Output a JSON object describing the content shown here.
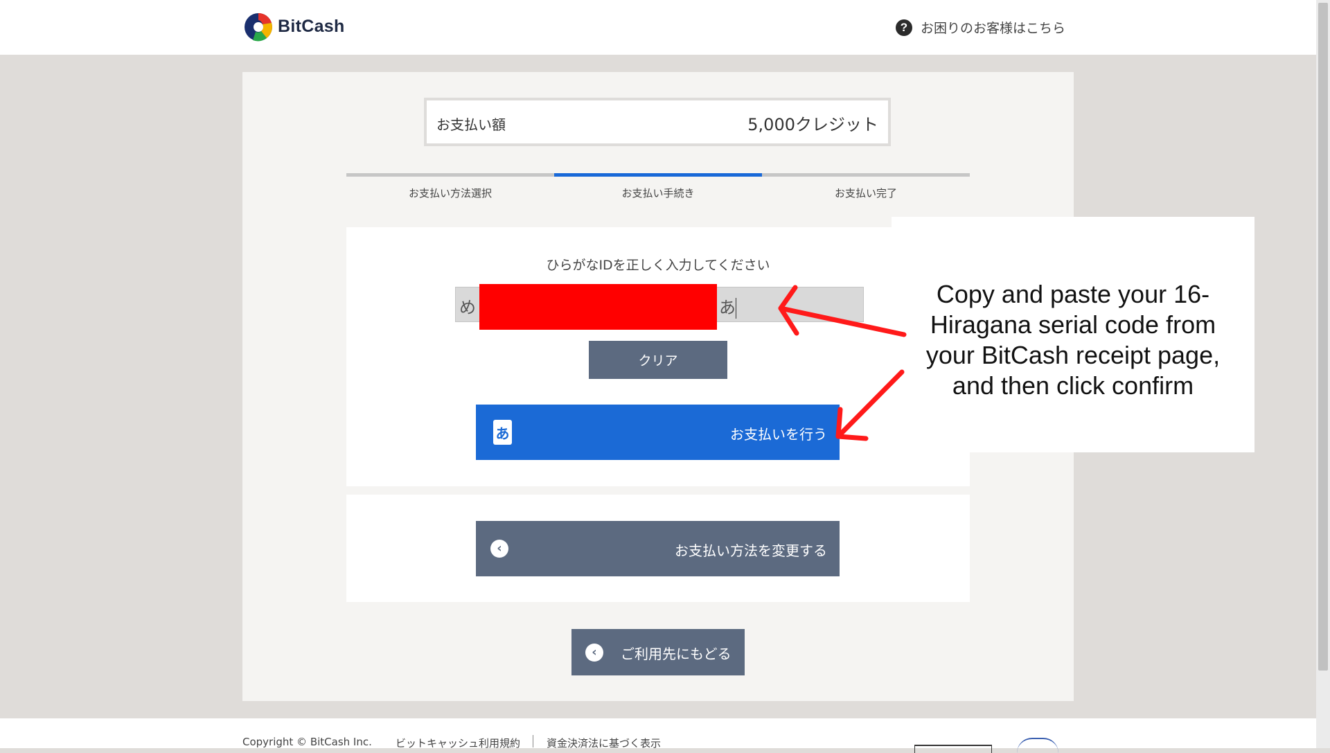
{
  "header": {
    "brand": "BitCash",
    "help_link": "お困りのお客様はこちら",
    "help_icon": "?"
  },
  "payment": {
    "amount_label": "お支払い額",
    "amount_value": "5,000クレジット"
  },
  "steps": [
    {
      "label": "お支払い方法選択",
      "active": false
    },
    {
      "label": "お支払い手続き",
      "active": true
    },
    {
      "label": "お支払い完了",
      "active": false
    }
  ],
  "form": {
    "title": "ひらがなIDを正しく入力してください",
    "input_start": "め",
    "input_end": "あ",
    "clear_label": "クリア",
    "pay_icon": "あ",
    "pay_label": "お支払いを行う"
  },
  "change_method_label": "お支払い方法を変更する",
  "return_label": "ご利用先にもどる",
  "footer": {
    "copyright": "Copyright © BitCash Inc.",
    "terms_link": "ビットキャッシュ利用規約",
    "disclosure_link": "資金決済法に基づく表示"
  },
  "annotation": {
    "text": "Copy and paste your 16-Hiragana serial code from your BitCash receipt page, and then click confirm",
    "lines": [
      "Copy and paste your 16-",
      "Hiragana serial code from",
      "your BitCash receipt page,",
      "and then click confirm"
    ]
  },
  "colors": {
    "primary_blue": "#1b6ad6",
    "slate_button": "#5c6a80",
    "active_step": "#1868d8",
    "redaction": "#ff0000",
    "arrow": "#ff1a1a"
  }
}
